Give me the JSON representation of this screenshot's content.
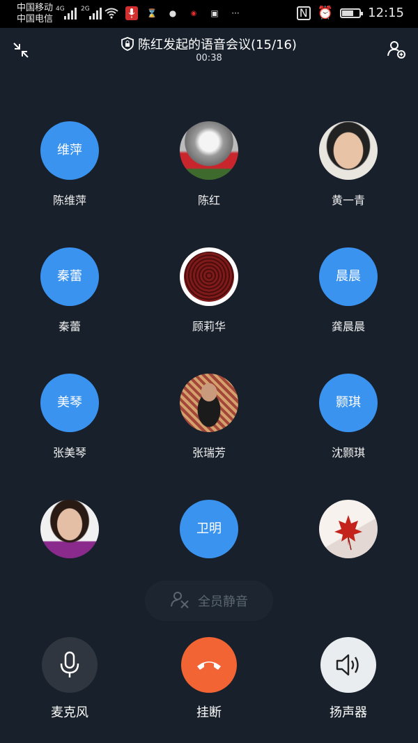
{
  "status_bar": {
    "carrier1": "中国移动",
    "carrier2": "中国电信",
    "net1": "4G",
    "net2": "2G",
    "time": "12:15",
    "battery_level": 0.6
  },
  "header": {
    "title": "陈红发起的语音会议(15/16)",
    "timer": "00:38"
  },
  "participants": [
    {
      "avatar_text": "维萍",
      "name": "陈维萍"
    },
    {
      "avatar_text": "",
      "name": "陈红"
    },
    {
      "avatar_text": "",
      "name": "黄一青"
    },
    {
      "avatar_text": "秦蕾",
      "name": "秦蕾"
    },
    {
      "avatar_text": "",
      "name": "顾莉华"
    },
    {
      "avatar_text": "晨晨",
      "name": "龚晨晨"
    },
    {
      "avatar_text": "美琴",
      "name": "张美琴"
    },
    {
      "avatar_text": "",
      "name": "张瑞芳"
    },
    {
      "avatar_text": "颢琪",
      "name": "沈颢琪"
    },
    {
      "avatar_text": "",
      "name": ""
    },
    {
      "avatar_text": "卫明",
      "name": ""
    },
    {
      "avatar_text": "",
      "name": ""
    }
  ],
  "mute_all": {
    "label": "全员静音"
  },
  "controls": {
    "mic_label": "麦克风",
    "hangup_label": "挂断",
    "speaker_label": "扬声器"
  },
  "colors": {
    "background": "#18202b",
    "avatar_blue": "#3b93f0",
    "hangup_orange": "#f26433"
  }
}
